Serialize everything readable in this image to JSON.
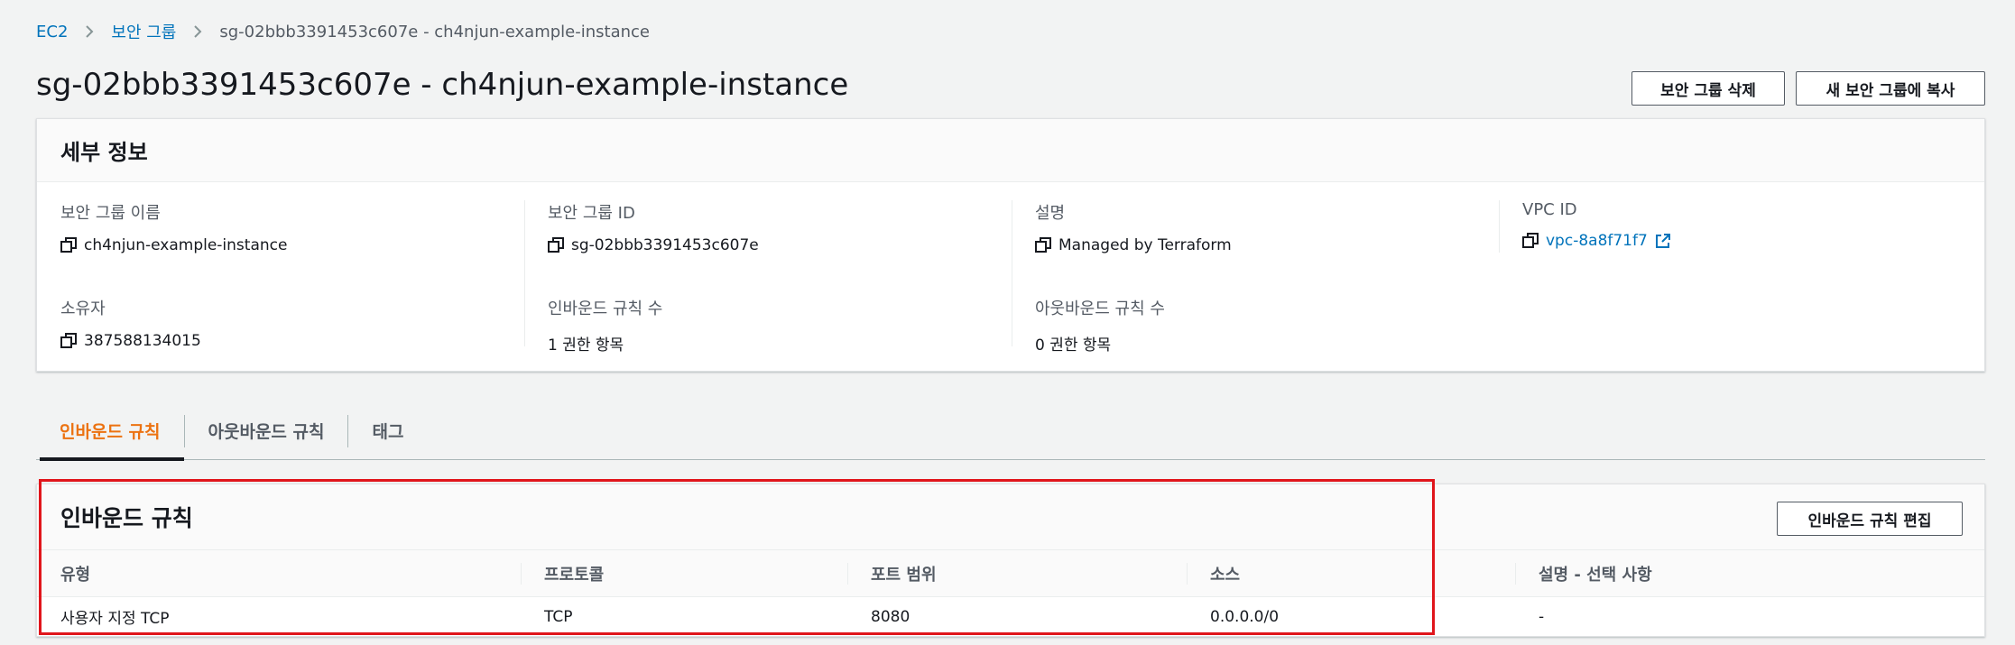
{
  "breadcrumb": {
    "items": [
      "EC2",
      "보안 그룹",
      "sg-02bbb3391453c607e - ch4njun-example-instance"
    ]
  },
  "page_title": "sg-02bbb3391453c607e - ch4njun-example-instance",
  "actions": {
    "delete_label": "보안 그룹 삭제",
    "copy_label": "새 보안 그룹에 복사"
  },
  "details": {
    "header": "세부 정보",
    "fields": [
      {
        "label": "보안 그룹 이름",
        "value": "ch4njun-example-instance",
        "copy": true
      },
      {
        "label": "보안 그룹 ID",
        "value": "sg-02bbb3391453c607e",
        "copy": true
      },
      {
        "label": "설명",
        "value": "Managed by Terraform",
        "copy": true
      },
      {
        "label": "VPC ID",
        "value": "vpc-8a8f71f7",
        "copy": true,
        "link": true
      },
      {
        "label": "소유자",
        "value": "387588134015",
        "copy": true
      },
      {
        "label": "인바운드 규칙 수",
        "value": "1 권한 항목"
      },
      {
        "label": "아웃바운드 규칙 수",
        "value": "0 권한 항목"
      }
    ]
  },
  "tabs": [
    {
      "label": "인바운드 규칙",
      "active": true
    },
    {
      "label": "아웃바운드 규칙",
      "active": false
    },
    {
      "label": "태그",
      "active": false
    }
  ],
  "inbound": {
    "title": "인바운드 규칙",
    "edit_label": "인바운드 규칙 편집",
    "columns": [
      "유형",
      "프로토콜",
      "포트 범위",
      "소스",
      "설명 - 선택 사항"
    ],
    "rows": [
      [
        "사용자 지정 TCP",
        "TCP",
        "8080",
        "0.0.0.0/0",
        "-"
      ]
    ]
  },
  "colors": {
    "link": "#0073bb",
    "active_tab": "#ec7211",
    "highlight": "#e0151b"
  }
}
